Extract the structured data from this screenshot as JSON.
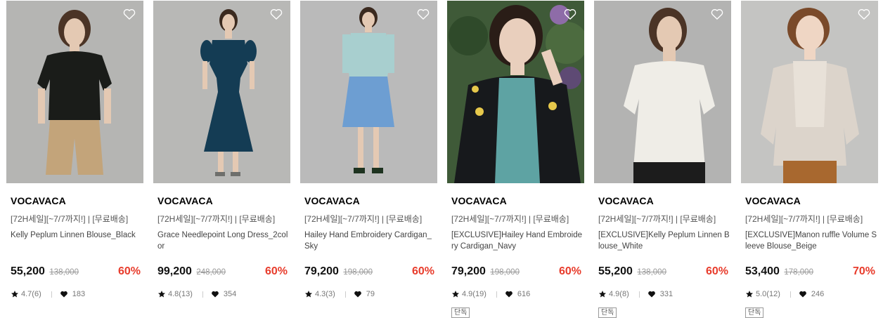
{
  "products": [
    {
      "brand": "VOCAVACA",
      "promo": "[72H세일][~7/7까지!] | [무료배송]",
      "name": "Kelly Peplum Linnen Blouse_Black",
      "price": "55,200",
      "original_price": "138,000",
      "discount": "60%",
      "rating": "4.7(6)",
      "likes": "183",
      "tag": null,
      "photo": {
        "bg": "#b5b5b3",
        "top": "#1a1c19",
        "bottom": "#c3a47a",
        "skin": "#e4c9b3",
        "hair": "#4b3426",
        "style": "blouse-shorts"
      }
    },
    {
      "brand": "VOCAVACA",
      "promo": "[72H세일][~7/7까지!] | [무료배송]",
      "name": "Grace Needlepoint Long Dress_2color",
      "price": "99,200",
      "original_price": "248,000",
      "discount": "60%",
      "rating": "4.8(13)",
      "likes": "354",
      "tag": null,
      "photo": {
        "bg": "#b8b8b6",
        "top": "#143c54",
        "bottom": "#143c54",
        "skin": "#e4c9b3",
        "hair": "#3b2a1f",
        "style": "long-dress"
      }
    },
    {
      "brand": "VOCAVACA",
      "promo": "[72H세일][~7/7까지!] | [무료배송]",
      "name": "Hailey Hand Embroidery Cardigan_Sky",
      "price": "79,200",
      "original_price": "198,000",
      "discount": "60%",
      "rating": "4.3(3)",
      "likes": "79",
      "tag": null,
      "photo": {
        "bg": "#bababa",
        "top": "#a8cfcf",
        "bottom": "#6d9ed2",
        "skin": "#e4c9b3",
        "hair": "#3b2a1f",
        "style": "cardigan-skirt"
      }
    },
    {
      "brand": "VOCAVACA",
      "promo": "[72H세일][~7/7까지!] | [무료배송]",
      "name": "[EXCLUSIVE]Hailey Hand Embroidery Cardigan_Navy",
      "price": "79,200",
      "original_price": "198,000",
      "discount": "60%",
      "rating": "4.9(19)",
      "likes": "616",
      "tag": "단독",
      "photo": {
        "bg": "#3f5a38",
        "top": "#17191c",
        "bottom": "#5ea3a3",
        "skin": "#e9cfbd",
        "hair": "#2a1d17",
        "style": "closeup-cardigan"
      }
    },
    {
      "brand": "VOCAVACA",
      "promo": "[72H세일][~7/7까지!] | [무료배송]",
      "name": "[EXCLUSIVE]Kelly Peplum Linnen Blouse_White",
      "price": "55,200",
      "original_price": "138,000",
      "discount": "60%",
      "rating": "4.9(8)",
      "likes": "331",
      "tag": "단독",
      "photo": {
        "bg": "#b3b3b2",
        "top": "#efede7",
        "bottom": "#1c1c1c",
        "skin": "#e4c9b3",
        "hair": "#4b3426",
        "style": "blouse-closeup"
      }
    },
    {
      "brand": "VOCAVACA",
      "promo": "[72H세일][~7/7까지!] | [무료배송]",
      "name": "[EXCLUSIVE]Manon ruffle Volume Sleeve Blouse_Beige",
      "price": "53,400",
      "original_price": "178,000",
      "discount": "70%",
      "rating": "5.0(12)",
      "likes": "246",
      "tag": "단독",
      "photo": {
        "bg": "#c4c4c2",
        "top": "#dcd4cb",
        "bottom": "#a8682f",
        "skin": "#efd6c4",
        "hair": "#7a4a2a",
        "style": "ruffle-blouse"
      }
    }
  ],
  "icons": {
    "wishlist": "heart-outline-icon",
    "rating": "star-icon",
    "likes": "heart-filled-icon"
  }
}
